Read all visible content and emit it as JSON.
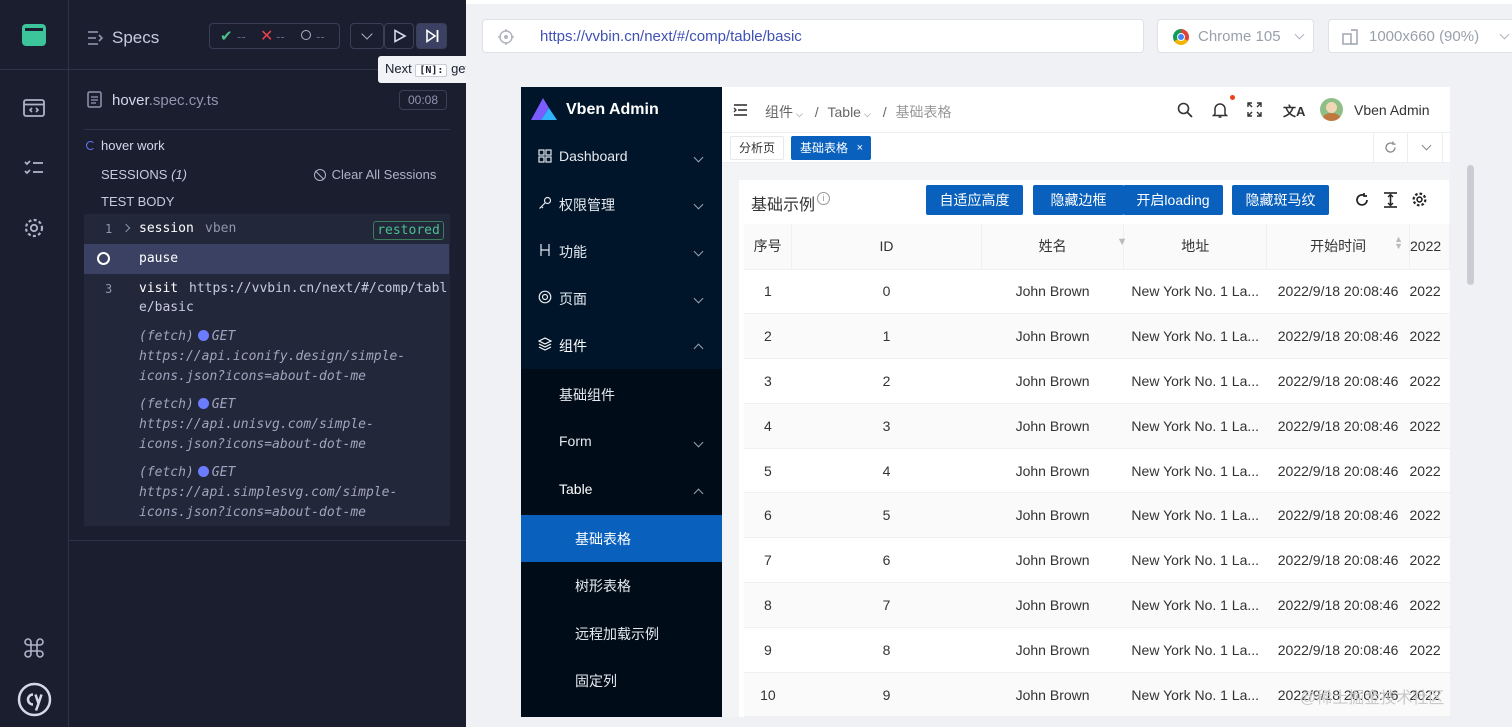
{
  "reporter": {
    "specs_label": "Specs",
    "stats": {
      "passed": "--",
      "failed": "--",
      "pending": "--"
    },
    "tooltip": {
      "label": "Next",
      "key": "[N]:",
      "suffix": "get"
    },
    "file": {
      "name": "hover",
      "ext": ".spec.cy.ts",
      "duration": "00:08"
    },
    "test_title": "hover work",
    "sessions_label": "SESSIONS",
    "sessions_count": "(1)",
    "clear_sessions": "Clear All Sessions",
    "test_body": "TEST BODY",
    "commands": [
      {
        "num": "1",
        "name": "session",
        "message": "vben",
        "badge": "restored"
      },
      {
        "num": "",
        "name": "pause",
        "message": ""
      },
      {
        "num": "3",
        "name": "visit",
        "message": "https://vvbin.cn/next/#/comp/tabl",
        "message2": "e/basic"
      }
    ],
    "fetches": [
      {
        "prefix": "(fetch)",
        "method": "GET",
        "line1": "https://api.iconify.design/simple-",
        "line2": "icons.json?icons=about-dot-me"
      },
      {
        "prefix": "(fetch)",
        "method": "GET",
        "line1": "https://api.unisvg.com/simple-",
        "line2": "icons.json?icons=about-dot-me"
      },
      {
        "prefix": "(fetch)",
        "method": "GET",
        "line1": "https://api.simplesvg.com/simple-",
        "line2": "icons.json?icons=about-dot-me"
      }
    ]
  },
  "aut": {
    "url": "https://vvbin.cn/next/#/comp/table/basic",
    "browser": "Chrome 105",
    "viewport": "1000x660 (90%)"
  },
  "app": {
    "brand": "Vben Admin",
    "menu": [
      {
        "label": "Dashboard"
      },
      {
        "label": "权限管理"
      },
      {
        "label": "功能"
      },
      {
        "label": "页面"
      },
      {
        "label": "组件"
      },
      {
        "label": "基础组件"
      },
      {
        "label": "Form"
      },
      {
        "label": "Table"
      },
      {
        "label": "基础表格"
      },
      {
        "label": "树形表格"
      },
      {
        "label": "远程加载示例"
      },
      {
        "label": "固定列"
      }
    ],
    "breadcrumb": [
      "组件",
      "Table",
      "基础表格"
    ],
    "user": "Vben Admin",
    "tabs": [
      "分析页",
      "基础表格"
    ],
    "table_title": "基础示例",
    "buttons": [
      "自适应高度",
      "隐藏边框",
      "开启loading",
      "隐藏斑马纹"
    ],
    "columns": [
      "序号",
      "ID",
      "姓名",
      "地址",
      "开始时间",
      "2022"
    ],
    "rows": [
      [
        "1",
        "0",
        "John Brown",
        "New York No. 1 La...",
        "2022/9/18 20:08:46",
        "2022"
      ],
      [
        "2",
        "1",
        "John Brown",
        "New York No. 1 La...",
        "2022/9/18 20:08:46",
        "2022"
      ],
      [
        "3",
        "2",
        "John Brown",
        "New York No. 1 La...",
        "2022/9/18 20:08:46",
        "2022"
      ],
      [
        "4",
        "3",
        "John Brown",
        "New York No. 1 La...",
        "2022/9/18 20:08:46",
        "2022"
      ],
      [
        "5",
        "4",
        "John Brown",
        "New York No. 1 La...",
        "2022/9/18 20:08:46",
        "2022"
      ],
      [
        "6",
        "5",
        "John Brown",
        "New York No. 1 La...",
        "2022/9/18 20:08:46",
        "2022"
      ],
      [
        "7",
        "6",
        "John Brown",
        "New York No. 1 La...",
        "2022/9/18 20:08:46",
        "2022"
      ],
      [
        "8",
        "7",
        "John Brown",
        "New York No. 1 La...",
        "2022/9/18 20:08:46",
        "2022"
      ],
      [
        "9",
        "8",
        "John Brown",
        "New York No. 1 La...",
        "2022/9/18 20:08:46",
        "2022"
      ],
      [
        "10",
        "9",
        "John Brown",
        "New York No. 1 La...",
        "2022/9/18 20:08:46",
        "2022"
      ]
    ]
  },
  "watermark": "@稀土掘金技术社区",
  "colors": {
    "rail_bg": "#1b1e2e",
    "app_sidebar": "#001529",
    "primary": "#0960bd",
    "pass": "#49c18e",
    "fail": "#e6434f"
  }
}
